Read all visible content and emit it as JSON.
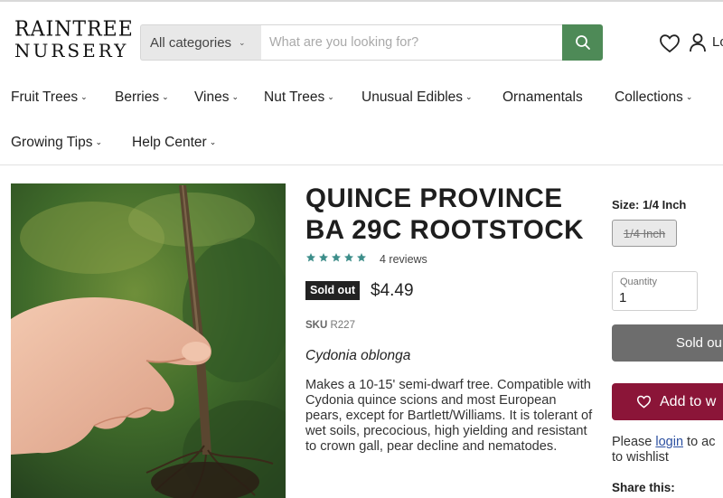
{
  "brand": {
    "line1": "RAINTREE",
    "line2": "NURSERY"
  },
  "search": {
    "category": "All categories",
    "placeholder": "What are you looking for?"
  },
  "header": {
    "login_label": "Lo"
  },
  "nav": {
    "items": [
      {
        "label": "Fruit Trees",
        "has_dropdown": true
      },
      {
        "label": "Berries",
        "has_dropdown": true
      },
      {
        "label": "Vines",
        "has_dropdown": true
      },
      {
        "label": "Nut Trees",
        "has_dropdown": true
      },
      {
        "label": "Unusual Edibles",
        "has_dropdown": true
      },
      {
        "label": "Ornamentals",
        "has_dropdown": false
      },
      {
        "label": "Collections",
        "has_dropdown": true
      },
      {
        "label": "Growing Tips",
        "has_dropdown": true
      },
      {
        "label": "Help Center",
        "has_dropdown": true
      }
    ]
  },
  "product": {
    "title_line1": "QUINCE PROVINCE",
    "title_line2": "BA 29C ROOTSTOCK",
    "rating": 5,
    "reviews_label": "4 reviews",
    "badge": "Sold out",
    "price": "$4.49",
    "sku_label": "SKU",
    "sku": "R227",
    "latin_name": "Cydonia oblonga",
    "description": "Makes a 10-15' semi-dwarf tree. Compatible with Cydonia quince scions and most European pears, except for Bartlett/Williams. It is tolerant of wet soils, precocious, high yielding and resistant to crown gall, pear decline and nematodes."
  },
  "purchase": {
    "size_label": "Size: 1/4 Inch",
    "size_option": "1/4 Inch",
    "quantity_label": "Quantity",
    "quantity_value": "1",
    "soldout_button": "Sold ou",
    "wishlist_button": "Add to w",
    "login_prefix": "Please ",
    "login_link": "login",
    "login_suffix": " to ac",
    "login_line2": "to wishlist",
    "share_label": "Share this:"
  },
  "colors": {
    "search_button": "#4e8a57",
    "star": "#3d8e8a",
    "wishlist_button": "#8b1538",
    "soldout_button": "#6d6d6d"
  },
  "icons": [
    "search-icon",
    "heart-icon",
    "user-icon",
    "star-icon",
    "chevron-down-icon"
  ]
}
